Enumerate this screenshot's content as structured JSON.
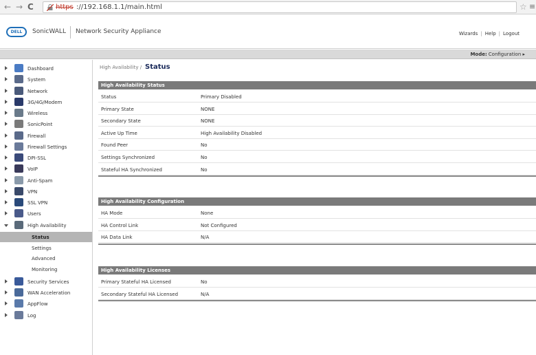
{
  "browser": {
    "back": "←",
    "forward": "→",
    "reload": "C",
    "url_scheme": "https",
    "url_rest": "://192.168.1.1/main.html",
    "star": "☆",
    "menu": "≡"
  },
  "header": {
    "logo_text": "DELL",
    "product": "SonicWALL",
    "appliance": "Network Security Appliance",
    "links": [
      "Wizards",
      "Help",
      "Logout"
    ],
    "link_separator": "|"
  },
  "mode_bar": {
    "label": "Mode:",
    "value": "Configuration ▸"
  },
  "sidebar": {
    "items": [
      {
        "label": "Dashboard",
        "icon": "dashboard-icon",
        "color": "#4a7bc4"
      },
      {
        "label": "System",
        "icon": "monitor-icon",
        "color": "#5a6a8a"
      },
      {
        "label": "Network",
        "icon": "globe-icon",
        "color": "#4a5a7a"
      },
      {
        "label": "3G/4G/Modem",
        "icon": "modem-icon",
        "color": "#2a3a6a"
      },
      {
        "label": "Wireless",
        "icon": "antenna-icon",
        "color": "#6a7a8a"
      },
      {
        "label": "SonicPoint",
        "icon": "access-point-icon",
        "color": "#7a7a7a"
      },
      {
        "label": "Firewall",
        "icon": "firewall-icon",
        "color": "#5a6a8a"
      },
      {
        "label": "Firewall Settings",
        "icon": "firewall-settings-icon",
        "color": "#6a7a9a"
      },
      {
        "label": "DPI-SSL",
        "icon": "dpi-ssl-icon",
        "color": "#3a4a7a"
      },
      {
        "label": "VoIP",
        "icon": "phone-icon",
        "color": "#3a3a5a"
      },
      {
        "label": "Anti-Spam",
        "icon": "mail-icon",
        "color": "#8a9aaa"
      },
      {
        "label": "VPN",
        "icon": "lock-icon",
        "color": "#3a4a6a"
      },
      {
        "label": "SSL VPN",
        "icon": "ssl-vpn-icon",
        "color": "#2a4a7a"
      },
      {
        "label": "Users",
        "icon": "users-icon",
        "color": "#4a5a8a"
      },
      {
        "label": "High Availability",
        "icon": "high-availability-icon",
        "color": "#5a6a7a"
      }
    ],
    "ha_sub_items": [
      "Status",
      "Settings",
      "Advanced",
      "Monitoring"
    ],
    "items_after": [
      {
        "label": "Security Services",
        "icon": "shield-icon",
        "color": "#3a5a9a"
      },
      {
        "label": "WAN Acceleration",
        "icon": "wan-acceleration-icon",
        "color": "#4a6a9a"
      },
      {
        "label": "AppFlow",
        "icon": "appflow-icon",
        "color": "#5a7aaa"
      },
      {
        "label": "Log",
        "icon": "log-icon",
        "color": "#6a7a9a"
      }
    ]
  },
  "main": {
    "breadcrumb": "High Availability /",
    "title": "Status",
    "sections": [
      {
        "title": "High Availability Status",
        "rows": [
          {
            "key": "Status",
            "value": "Primary Disabled"
          },
          {
            "key": "Primary State",
            "value": "NONE"
          },
          {
            "key": "Secondary State",
            "value": "NONE"
          },
          {
            "key": "Active Up Time",
            "value": "High Availability Disabled"
          },
          {
            "key": "Found Peer",
            "value": "No"
          },
          {
            "key": "Settings Synchronized",
            "value": "No"
          },
          {
            "key": "Stateful HA Synchronized",
            "value": "No"
          }
        ]
      },
      {
        "title": "High Availability Configuration",
        "rows": [
          {
            "key": "HA Mode",
            "value": "None"
          },
          {
            "key": "HA Control Link",
            "value": "Not Configured"
          },
          {
            "key": "HA Data Link",
            "value": "N/A"
          }
        ]
      },
      {
        "title": "High Availability Licenses",
        "rows": [
          {
            "key": "Primary Stateful HA Licensed",
            "value": "No"
          },
          {
            "key": "Secondary Stateful HA Licensed",
            "value": "N/A"
          }
        ]
      }
    ]
  }
}
